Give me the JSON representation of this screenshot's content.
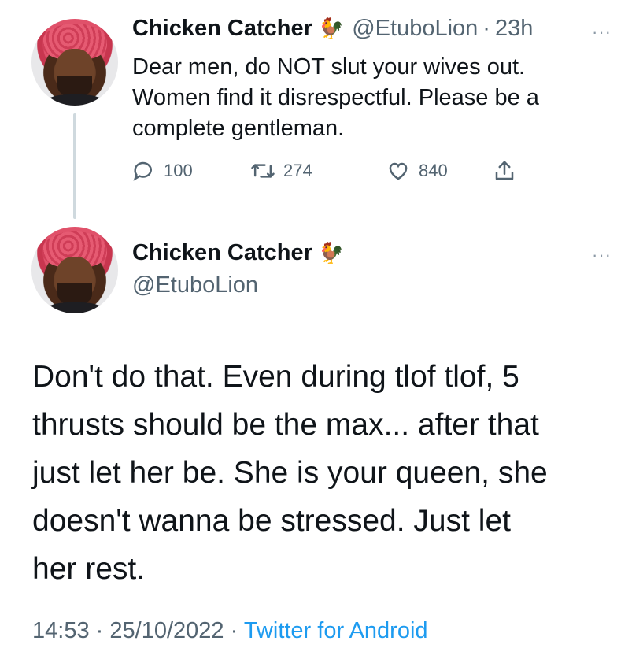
{
  "reply_parent": {
    "author_name": "Chicken Catcher",
    "author_emoji": "🐓",
    "handle": "@EtuboLion",
    "separator": "·",
    "time_ago": "23h",
    "more": "···",
    "text_lines": [
      "Dear men, do NOT slut your wives out.",
      "Women find it disrespectful. Please be a",
      "complete gentleman."
    ],
    "actions": {
      "replies": "100",
      "retweets": "274",
      "likes": "840"
    }
  },
  "main_tweet": {
    "author_name": "Chicken Catcher",
    "author_emoji": "🐓",
    "handle": "@EtuboLion",
    "more": "···",
    "text_lines": [
      "Don't do that. Even during tlof tlof, 5",
      "thrusts should be the max... after that",
      "just let her be. She is your queen, she",
      "doesn't wanna be stressed. Just let",
      "her rest."
    ],
    "time": "14:53",
    "separator": "·",
    "date": "25/10/2022",
    "source": "Twitter for Android"
  },
  "colors": {
    "text": "#0f1419",
    "secondary": "#536471",
    "link": "#1d9bf0",
    "thread_line": "#cfd9de"
  },
  "icons": [
    "reply-icon",
    "retweet-icon",
    "like-icon",
    "share-icon",
    "more-icon",
    "avatar"
  ]
}
